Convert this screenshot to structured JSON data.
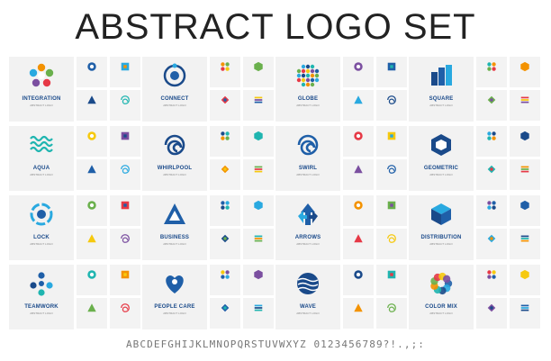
{
  "title": "ABSTRACT LOGO SET",
  "alphabet": "ABCDEFGHIJKLMNOPQRSTUVWXYZ 0123456789?!.,;:",
  "palette": {
    "blue": "#1f5fa8",
    "cyan": "#29a9e0",
    "navy": "#1a4a8a",
    "teal": "#1fb5b0",
    "orange": "#f39200",
    "green": "#6ab04c",
    "red": "#e63946",
    "yellow": "#f6c90e",
    "purple": "#7b4fa0"
  },
  "featured": [
    {
      "name": "INTEGRATION",
      "sub": "ABSTRACT LOGO",
      "icon": "integration-icon"
    },
    {
      "name": "CONNECT",
      "sub": "ABSTRACT LOGO",
      "icon": "connect-icon"
    },
    {
      "name": "GLOBE",
      "sub": "ABSTRACT LOGO",
      "icon": "globe-icon"
    },
    {
      "name": "SQUARE",
      "sub": "ABSTRACT LOGO",
      "icon": "square-buildings-icon"
    },
    {
      "name": "AQUA",
      "sub": "ABSTRACT LOGO",
      "icon": "aqua-waves-icon"
    },
    {
      "name": "WHIRLPOOL",
      "sub": "ABSTRACT LOGO",
      "icon": "whirlpool-icon"
    },
    {
      "name": "SWIRL",
      "sub": "ABSTRACT LOGO",
      "icon": "swirl-icon"
    },
    {
      "name": "GEOMETRIC",
      "sub": "ABSTRACT LOGO",
      "icon": "hexagon-icon"
    },
    {
      "name": "LOCK",
      "sub": "ABSTRACT LOGO",
      "icon": "lock-ring-icon"
    },
    {
      "name": "BUSINESS",
      "sub": "ABSTRACT LOGO",
      "icon": "triangle-icon"
    },
    {
      "name": "ARROWS",
      "sub": "ABSTRACT LOGO",
      "icon": "arrows-icon"
    },
    {
      "name": "DISTRIBUTION",
      "sub": "ABSTRACT LOGO",
      "icon": "cube-icon"
    },
    {
      "name": "TEAMWORK",
      "sub": "ABSTRACT LOGO",
      "icon": "teamwork-icon"
    },
    {
      "name": "PEOPLE CARE",
      "sub": "ABSTRACT LOGO",
      "icon": "people-care-icon"
    },
    {
      "name": "WAVE",
      "sub": "ABSTRACT LOGO",
      "icon": "wave-sphere-icon"
    },
    {
      "name": "COLOR MIX",
      "sub": "ABSTRACT LOGO",
      "icon": "color-mix-icon"
    }
  ]
}
